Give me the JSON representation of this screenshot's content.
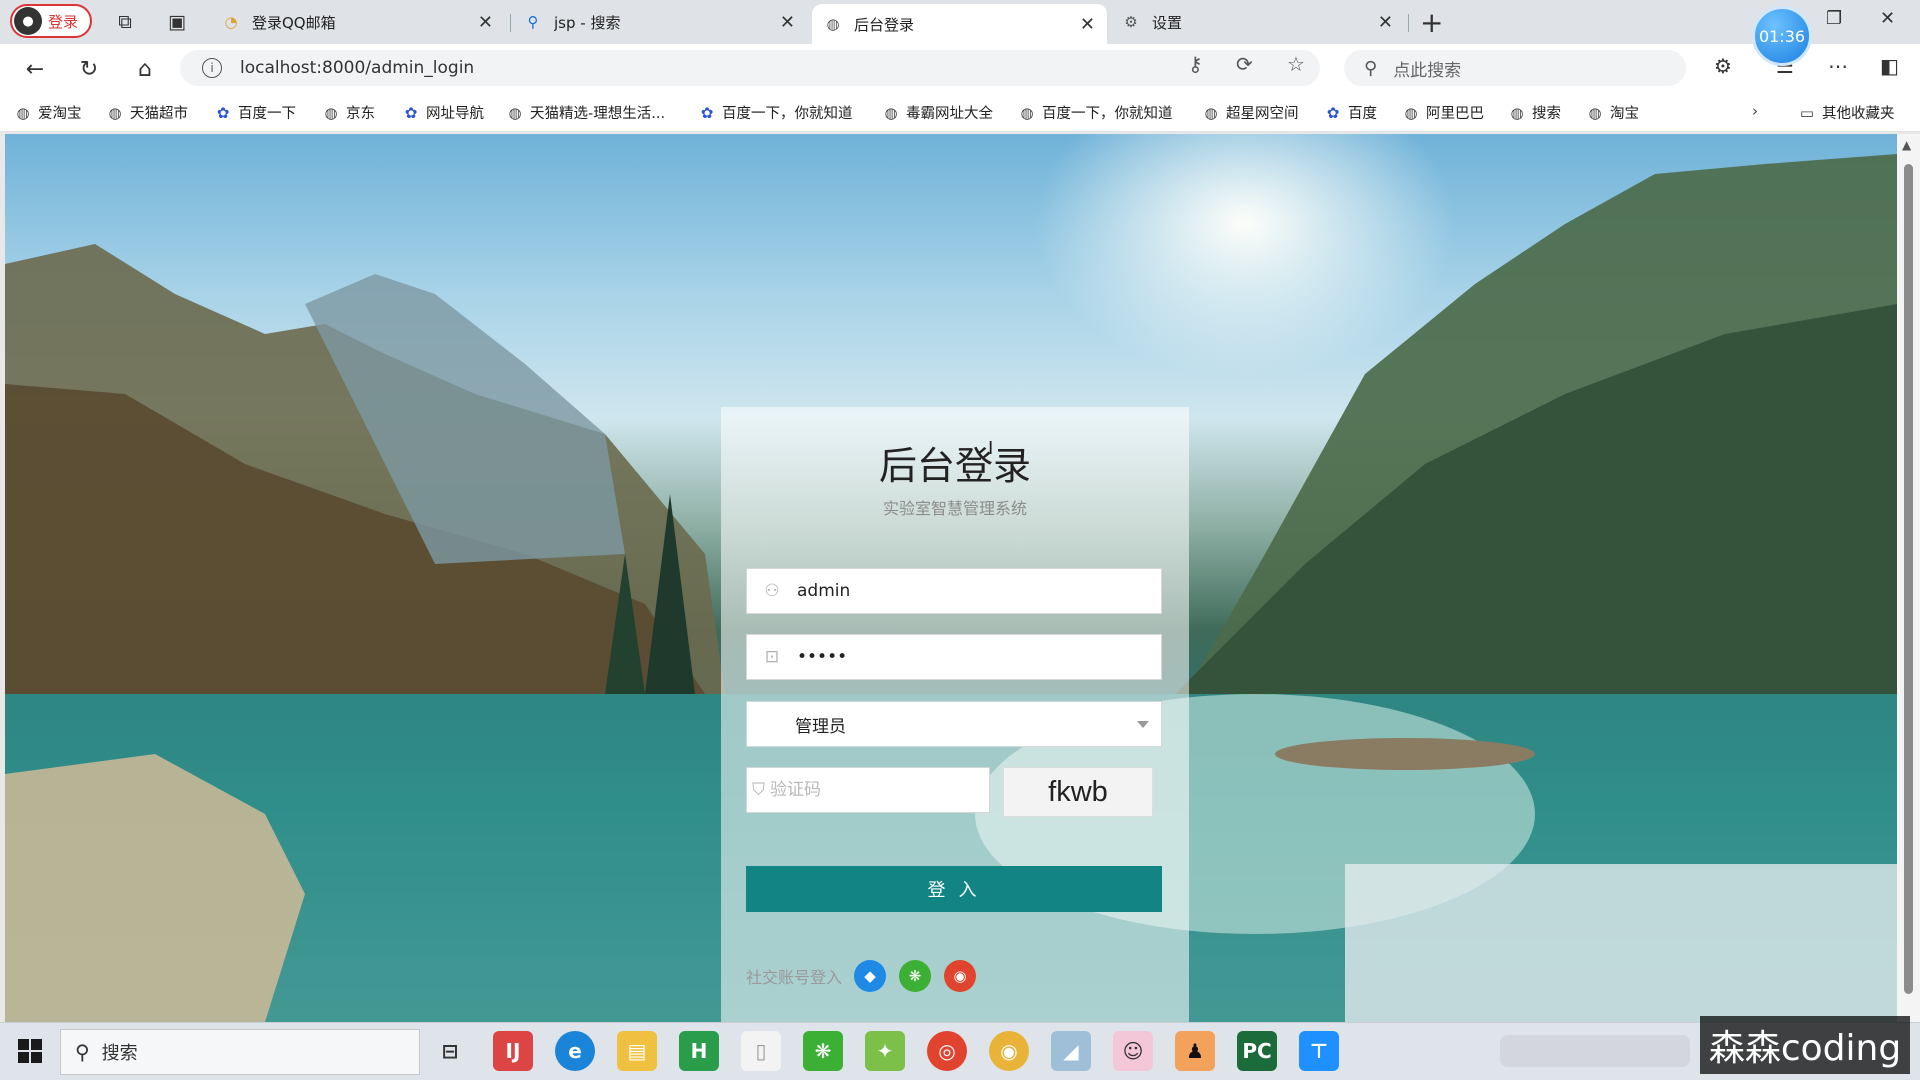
{
  "browser": {
    "profile_label": "登录",
    "clock": "01:36",
    "tabs": [
      {
        "title": "登录QQ邮箱",
        "icon": "colorful-circle-icon"
      },
      {
        "title": "jsp - 搜索",
        "icon": "search-icon"
      },
      {
        "title": "后台登录",
        "icon": "globe-icon",
        "active": true
      },
      {
        "title": "设置",
        "icon": "gear-icon"
      }
    ],
    "address": "localhost:8000/admin_login",
    "search_placeholder": "点此搜索",
    "bookmarks": [
      {
        "label": "爱淘宝",
        "icon": "globe-icon"
      },
      {
        "label": "天猫超市",
        "icon": "globe-icon"
      },
      {
        "label": "百度一下",
        "icon": "baidu-paw-icon"
      },
      {
        "label": "京东",
        "icon": "globe-icon"
      },
      {
        "label": "网址导航",
        "icon": "baidu-paw-icon"
      },
      {
        "label": "天猫精选-理想生活...",
        "icon": "globe-icon"
      },
      {
        "label": "百度一下，你就知道",
        "icon": "baidu-paw-icon"
      },
      {
        "label": "毒霸网址大全",
        "icon": "globe-icon"
      },
      {
        "label": "百度一下，你就知道",
        "icon": "globe-icon"
      },
      {
        "label": "超星网空间",
        "icon": "globe-icon"
      },
      {
        "label": "百度",
        "icon": "baidu-paw-icon"
      },
      {
        "label": "阿里巴巴",
        "icon": "globe-icon"
      },
      {
        "label": "搜索",
        "icon": "globe-icon"
      },
      {
        "label": "淘宝",
        "icon": "globe-icon"
      }
    ],
    "other_bookmarks": "其他收藏夹"
  },
  "login": {
    "title": "后台登录",
    "subtitle": "实验室智慧管理系统",
    "username": "admin",
    "password": "•••••",
    "role": "管理员",
    "captcha_placeholder": "验证码",
    "captcha_code": "fkwb",
    "submit": "登 入",
    "social_label": "社交账号登入",
    "social": [
      "qq-icon",
      "wechat-icon",
      "weibo-icon"
    ]
  },
  "taskbar": {
    "search_placeholder": "搜索",
    "watermark": "森森coding"
  }
}
